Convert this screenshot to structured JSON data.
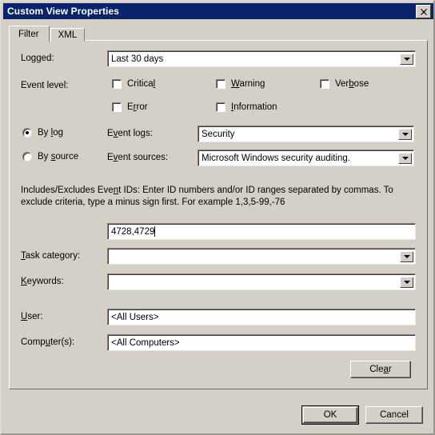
{
  "window": {
    "title": "Custom View Properties",
    "close_icon": "close-icon",
    "close_glyph": "✖"
  },
  "tabs": [
    {
      "label": "Filter",
      "active": true
    },
    {
      "label": "XML",
      "active": false
    }
  ],
  "filter": {
    "logged": {
      "label": "Logged:",
      "accel": "g",
      "value": "Last 30 days"
    },
    "event_level": {
      "label": "Event level:",
      "options": [
        {
          "label": "Critical",
          "accel": "l",
          "checked": false
        },
        {
          "label": "Warning",
          "accel": "W",
          "checked": false
        },
        {
          "label": "Verbose",
          "accel": "b",
          "checked": false
        },
        {
          "label": "Error",
          "accel": "r",
          "checked": false
        },
        {
          "label": "Information",
          "accel": "I",
          "checked": false
        }
      ]
    },
    "source_mode": {
      "by_log": {
        "label": "By log",
        "accel": "l",
        "selected": true
      },
      "by_source": {
        "label": "By source",
        "accel": "s",
        "selected": false
      }
    },
    "event_logs": {
      "label": "Event logs:",
      "accel": "v",
      "value": "Security"
    },
    "event_sources": {
      "label": "Event sources:",
      "accel": "v",
      "value": "Microsoft Windows security auditing."
    },
    "event_ids": {
      "help": "Includes/Excludes Event IDs: Enter ID numbers and/or ID ranges separated by commas. To exclude criteria, type a minus sign first. For example 1,3,5-99,-76",
      "help_accel": "n",
      "value": "4728,4729"
    },
    "task_category": {
      "label": "Task category:",
      "accel": "T",
      "value": ""
    },
    "keywords": {
      "label": "Keywords:",
      "accel": "K",
      "value": ""
    },
    "user": {
      "label": "User:",
      "accel": "U",
      "value": "<All Users>"
    },
    "computers": {
      "label": "Computer(s):",
      "accel": "u",
      "value": "<All Computers>"
    },
    "clear_button": {
      "label": "Clear",
      "accel": "a"
    }
  },
  "footer": {
    "ok_label": "OK",
    "cancel_label": "Cancel"
  },
  "colors": {
    "titlebar": "#0a246a",
    "dialog_face": "#d4d0c8",
    "field_bg": "#ffffff",
    "text": "#000000"
  }
}
